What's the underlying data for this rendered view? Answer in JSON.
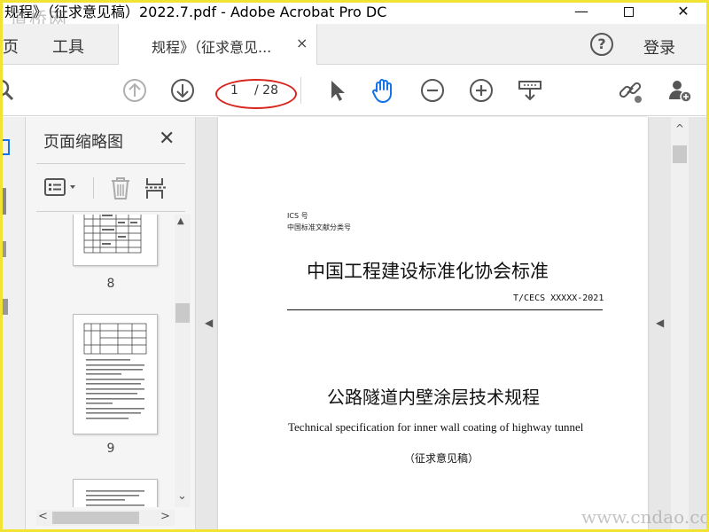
{
  "window": {
    "title": "规程》（征求意见稿）2022.7.pdf - Adobe Acrobat Pro DC",
    "minimize": "—",
    "close": "✕"
  },
  "tabs": {
    "home": "主页",
    "tools": "工具",
    "document": "规程》（征求意见...",
    "close": "×",
    "help": "?",
    "login": "登录"
  },
  "toolbar": {
    "current_page": "1",
    "total_pages": "/ 28"
  },
  "thumbnail_panel": {
    "title": "页面缩略图",
    "close": "✕",
    "page_labels": [
      "8",
      "9"
    ],
    "scroll_up": "▲",
    "scroll_down": "⌄",
    "scroll_left": "<",
    "scroll_right": ">"
  },
  "document": {
    "ics": "ICS 号",
    "classification": "中国标准文献分类号",
    "organization": "中国工程建设标准化协会标准",
    "code": "T/CECS XXXXX-2021",
    "title_cn": "公路隧道内壁涂层技术规程",
    "title_en": "Technical specification for inner wall coating of highway tunnel",
    "stage": "（征求意见稿）",
    "scroll_up": "^",
    "collapse_left": "◀",
    "collapse_right": "◀"
  },
  "watermarks": {
    "top": "道桥网",
    "bottom": "www.cndao.com"
  },
  "colors": {
    "accent_blue": "#1473e6",
    "annotation_red": "#d9231d",
    "frame_yellow": "#f2e233"
  }
}
